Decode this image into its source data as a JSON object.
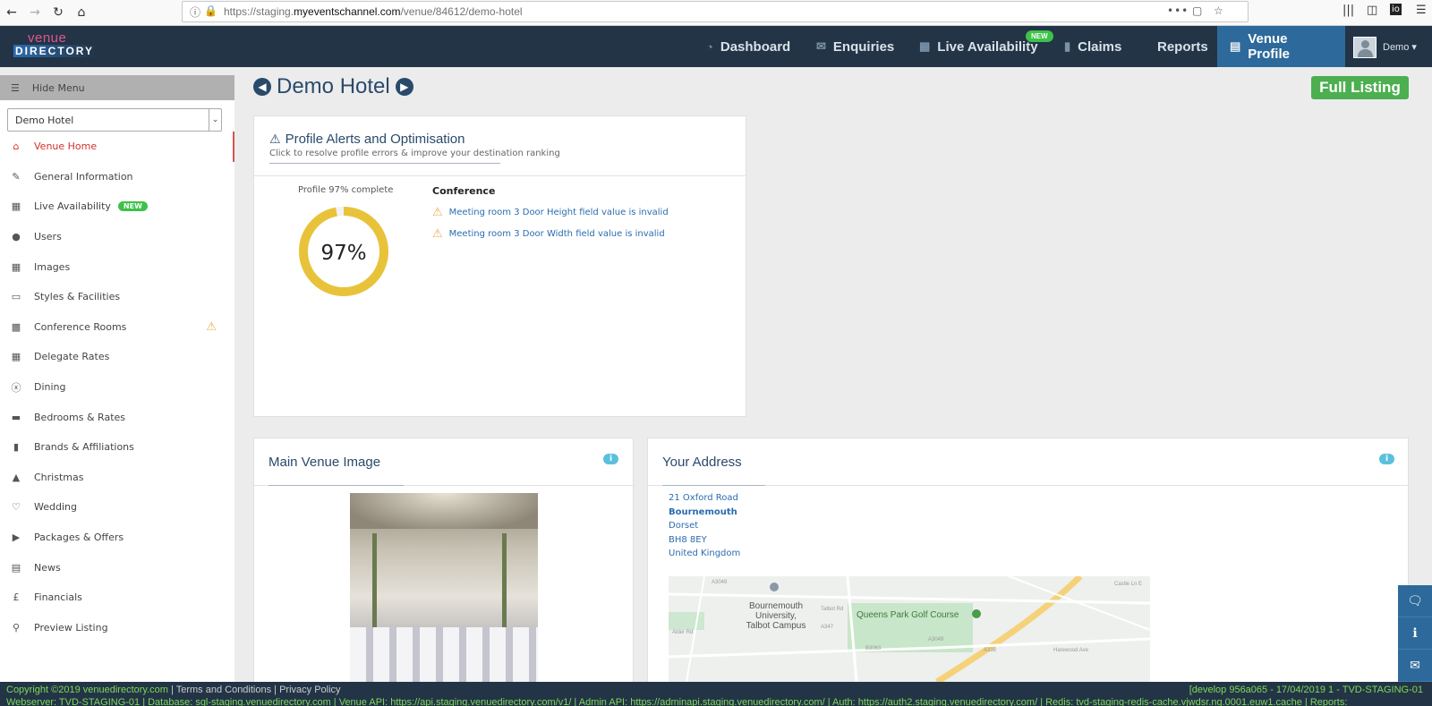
{
  "browser": {
    "url_prefix": "https://staging.",
    "url_host": "myeventschannel.com",
    "url_path": "/venue/84612/demo-hotel"
  },
  "nav": {
    "logo_top": "venue",
    "logo_bottom": "DIRECTORY",
    "items": [
      {
        "label": "Dashboard",
        "icon": "tachometer-icon"
      },
      {
        "label": "Enquiries",
        "icon": "envelope-icon"
      },
      {
        "label": "Live Availability",
        "icon": "calendar-icon",
        "badge": "NEW"
      },
      {
        "label": "Claims",
        "icon": "book-icon"
      },
      {
        "label": "Reports"
      },
      {
        "label": "Venue Profile",
        "icon": "document-icon",
        "active": true
      }
    ],
    "user": "Demo ▾"
  },
  "sidebar": {
    "hide_menu": "Hide Menu",
    "venue_select": "Demo Hotel",
    "items": [
      {
        "label": "Venue Home",
        "icon": "home-icon",
        "active": true
      },
      {
        "label": "General Information",
        "icon": "edit-icon"
      },
      {
        "label": "Live Availability",
        "icon": "calendar-icon",
        "badge": "NEW"
      },
      {
        "label": "Users",
        "icon": "user-icon"
      },
      {
        "label": "Images",
        "icon": "image-icon"
      },
      {
        "label": "Styles & Facilities",
        "icon": "monitor-icon"
      },
      {
        "label": "Conference Rooms",
        "icon": "briefcase-icon",
        "warning": true
      },
      {
        "label": "Delegate Rates",
        "icon": "calculator-icon"
      },
      {
        "label": "Dining",
        "icon": "cutlery-icon"
      },
      {
        "label": "Bedrooms & Rates",
        "icon": "bed-icon"
      },
      {
        "label": "Brands & Affiliations",
        "icon": "book-icon"
      },
      {
        "label": "Christmas",
        "icon": "tree-icon"
      },
      {
        "label": "Wedding",
        "icon": "heart-icon"
      },
      {
        "label": "Packages & Offers",
        "icon": "tags-icon"
      },
      {
        "label": "News",
        "icon": "newspaper-icon"
      },
      {
        "label": "Financials",
        "icon": "pound-icon"
      },
      {
        "label": "Preview Listing",
        "icon": "search-icon"
      }
    ]
  },
  "main": {
    "title": "Demo Hotel",
    "full_listing": "Full Listing",
    "alerts_panel": {
      "title": "Profile Alerts and Optimisation",
      "subtitle": "Click to resolve profile errors & improve your destination ranking",
      "complete_label": "Profile 97% complete",
      "percent_text": "97%",
      "percent_value": 97,
      "section": "Conference",
      "alerts": [
        "Meeting room 3 Door Height field value is invalid",
        "Meeting room 3 Door Width field value is invalid"
      ]
    },
    "image_panel": {
      "title": "Main Venue Image"
    },
    "address_panel": {
      "title": "Your Address",
      "lines": [
        "21 Oxford Road",
        "Bournemouth",
        "Dorset",
        "BH8 8EY",
        "United Kingdom"
      ]
    },
    "map": {
      "labels": [
        "Bournemouth University, Talbot Campus",
        "Queens Park Golf Course"
      ],
      "roads": [
        "A3049",
        "Talbot Rd",
        "A347",
        "B3063",
        "A3049",
        "A338",
        "Harewood Ave",
        "Castle Ln E",
        "Alder Rd"
      ]
    }
  },
  "footer": {
    "copyright": "Copyright ©2019 venuedirectory.com",
    "sep": " | ",
    "terms": "Terms and Conditions",
    "privacy": "Privacy Policy",
    "build": "[develop 956a065 - 17/04/2019 1 - TVD-STAGING-01",
    "line2": "Webserver: TVD-STAGING-01 | Database: sql-staging.venuedirectory.com | Venue API: https://api.staging.venuedirectory.com/v1/ | Admin API: https://adminapi.staging.venuedirectory.com/ | Auth: https://auth2.staging.venuedirectory.com/ | Redis: tvd-staging-redis-cache.vjwdsr.ng.0001.euw1.cache | Reports:"
  },
  "colors": {
    "nav_bg": "#233446",
    "active_nav": "#2d6a9b",
    "accent_red": "#d2322d",
    "green": "#4caf50",
    "donut": "#e8c33a",
    "warning": "#f0ad4e"
  }
}
